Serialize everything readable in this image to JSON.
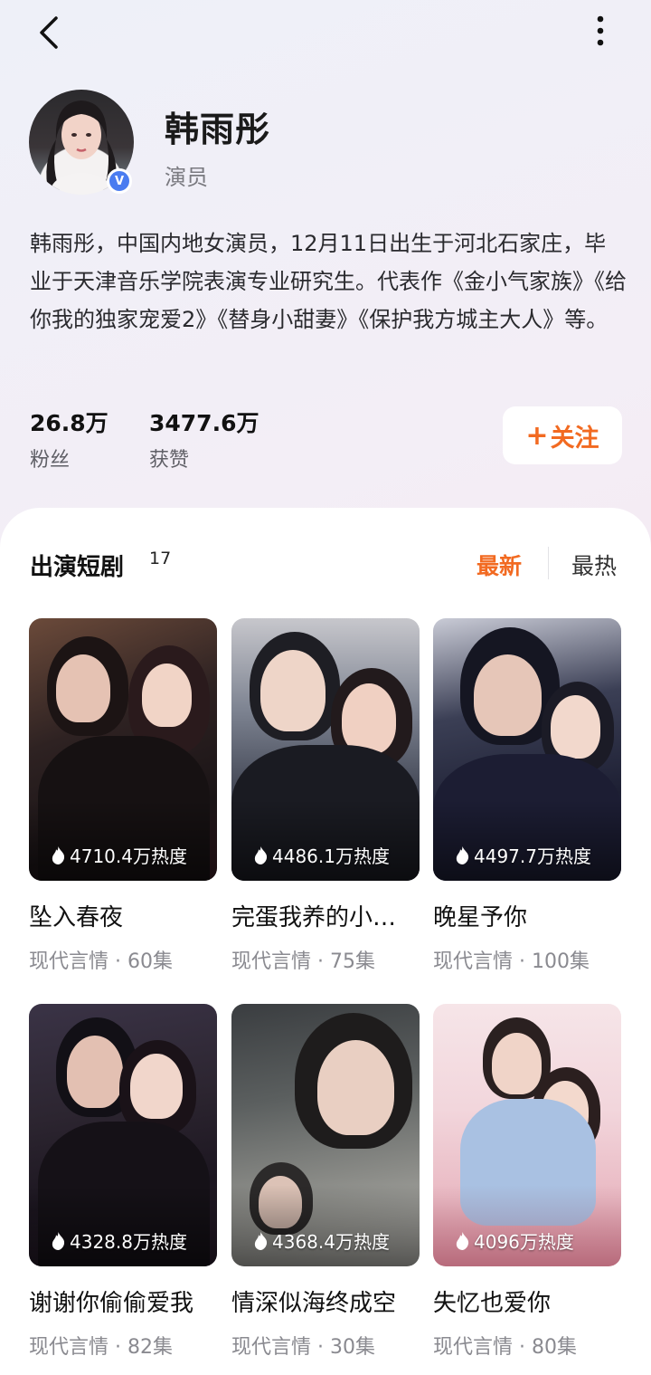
{
  "header": {
    "back_icon": "chevron-left-icon",
    "more_icon": "more-vertical-icon"
  },
  "profile": {
    "name": "韩雨彤",
    "role": "演员",
    "verified": "V",
    "bio": "韩雨彤，中国内地女演员，12月11日出生于河北石家庄，毕业于天津音乐学院表演专业研究生。代表作《金小气家族》《给你我的独家宠爱2》《替身小甜妻》《保护我方城主大人》等。",
    "stats": [
      {
        "value": "26.8万",
        "label": "粉丝"
      },
      {
        "value": "3477.6万",
        "label": "获赞"
      }
    ],
    "follow": {
      "plus": "+",
      "label": "关注"
    }
  },
  "dramas": {
    "title": "出演短剧",
    "count": "17",
    "tabs": {
      "newest": "最新",
      "hottest": "最热",
      "active": "最新"
    },
    "items": [
      {
        "title": "坠入春夜",
        "heat": "4710.4万热度",
        "meta": "现代言情 · 60集"
      },
      {
        "title": "完蛋我养的小白脸是大佬",
        "heat": "4486.1万热度",
        "meta": "现代言情 · 75集"
      },
      {
        "title": "晚星予你",
        "heat": "4497.7万热度",
        "meta": "现代言情 · 100集"
      },
      {
        "title": "谢谢你偷偷爱我",
        "heat": "4328.8万热度",
        "meta": "现代言情 · 82集"
      },
      {
        "title": "情深似海终成空",
        "heat": "4368.4万热度",
        "meta": "现代言情 · 30集"
      },
      {
        "title": "失忆也爱你",
        "heat": "4096万热度",
        "meta": "现代言情 · 80集"
      }
    ]
  },
  "colors": {
    "accent": "#f26a21",
    "verified": "#4a7cf0",
    "meta_text": "#8a8a90"
  }
}
